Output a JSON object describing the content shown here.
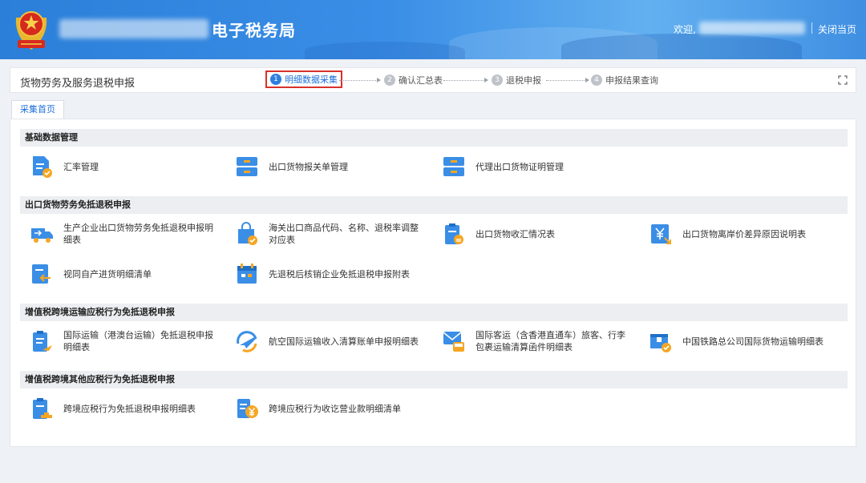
{
  "header": {
    "brand": "电子税务局",
    "welcome": "欢迎,",
    "close_label": "关闭当页"
  },
  "titlebar": {
    "title": "货物劳务及服务退税申报"
  },
  "steps": [
    {
      "num": "1",
      "label": "明细数据采集"
    },
    {
      "num": "2",
      "label": "确认汇总表"
    },
    {
      "num": "3",
      "label": "退税申报"
    },
    {
      "num": "4",
      "label": "申报结果查询"
    }
  ],
  "tab": {
    "label": "采集首页"
  },
  "sections": [
    {
      "title": "基础数据管理",
      "items": [
        {
          "label": "汇率管理",
          "icon": "doc-check-icon"
        },
        {
          "label": "出口货物报关单管理",
          "icon": "cabinet-icon"
        },
        {
          "label": "代理出口货物证明管理",
          "icon": "cabinet-icon"
        }
      ]
    },
    {
      "title": "出口货物劳务免抵退税申报",
      "items": [
        {
          "label": "生产企业出口货物劳务免抵退税申报明细表",
          "icon": "truck-icon"
        },
        {
          "label": "海关出口商品代码、名称、退税率调整对应表",
          "icon": "bag-icon"
        },
        {
          "label": "出口货物收汇情况表",
          "icon": "clipboard-coin-icon"
        },
        {
          "label": "出口货物离岸价差异原因说明表",
          "icon": "yen-doc-icon"
        },
        {
          "label": "视同自产进货明细清单",
          "icon": "doc-arrow-icon"
        },
        {
          "label": "先退税后核销企业免抵退税申报附表",
          "icon": "calendar-icon"
        }
      ]
    },
    {
      "title": "增值税跨境运输应税行为免抵退税申报",
      "items": [
        {
          "label": "国际运输（港澳台运输）免抵退税申报明细表",
          "icon": "clipboard-plane-icon"
        },
        {
          "label": "航空国际运输收入清算账单申报明细表",
          "icon": "plane-icon"
        },
        {
          "label": "国际客运（含香港直通车）旅客、行李包裹运输清算函件明细表",
          "icon": "mail-bus-icon"
        },
        {
          "label": "中国铁路总公司国际货物运输明细表",
          "icon": "box-check-icon"
        }
      ]
    },
    {
      "title": "增值税跨境其他应税行为免抵退税申报",
      "items": [
        {
          "label": "跨境应税行为免抵退税申报明细表",
          "icon": "clipboard-stamp-icon"
        },
        {
          "label": "跨境应税行为收讫营业款明细清单",
          "icon": "doc-yen-icon"
        }
      ]
    }
  ],
  "colors": {
    "blue": "#3a8ee6",
    "orange": "#f5a623",
    "active_step": "#1e6fd9",
    "highlight_border": "#d8312b"
  }
}
